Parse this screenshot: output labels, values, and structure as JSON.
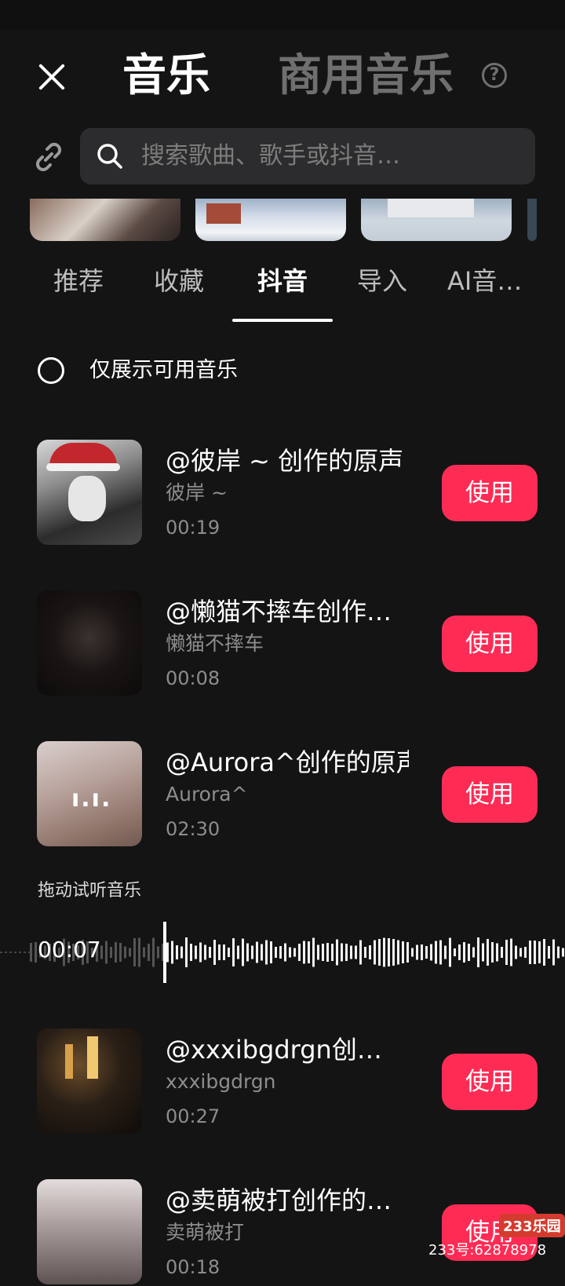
{
  "header": {
    "close_icon": "close-icon",
    "title": "音乐",
    "alt_title": "商用音乐",
    "help_icon_glyph": "?"
  },
  "search": {
    "link_icon": "link-icon",
    "placeholder": "搜索歌曲、歌手或抖音…"
  },
  "tabs": [
    {
      "label": "推荐",
      "active": false
    },
    {
      "label": "收藏",
      "active": false
    },
    {
      "label": "抖音",
      "active": true
    },
    {
      "label": "导入",
      "active": false
    },
    {
      "label": "AI音…",
      "active": false
    }
  ],
  "filter": {
    "label": "仅展示可用音乐",
    "checked": false
  },
  "tracks": [
    {
      "title": "@彼岸 ~ 创作的原声",
      "artist": "彼岸 ~",
      "duration": "00:19",
      "button": "使用"
    },
    {
      "title": "@懒猫不摔车创作…",
      "artist": "懒猫不摔车",
      "duration": "00:08",
      "button": "使用"
    },
    {
      "title": "@Aurora^创作的原声",
      "artist": "Aurora^",
      "duration": "02:30",
      "button": "使用",
      "playing_glyph": "ı.ı."
    },
    {
      "title": "@xxxibgdrgn创…",
      "artist": "xxxibgdrgn",
      "duration": "00:27",
      "button": "使用"
    },
    {
      "title": "@卖萌被打创作的…",
      "artist": "卖萌被打",
      "duration": "00:18",
      "button": "使用"
    }
  ],
  "preview": {
    "label": "拖动试听音乐",
    "position": "00:07"
  },
  "colors": {
    "background": "#141414",
    "accent": "#fe2c55",
    "search_bg": "#2c2c2e",
    "muted_text": "#8d8d8d"
  },
  "watermark": {
    "logo": "233乐园",
    "text": "233号:62878978"
  }
}
